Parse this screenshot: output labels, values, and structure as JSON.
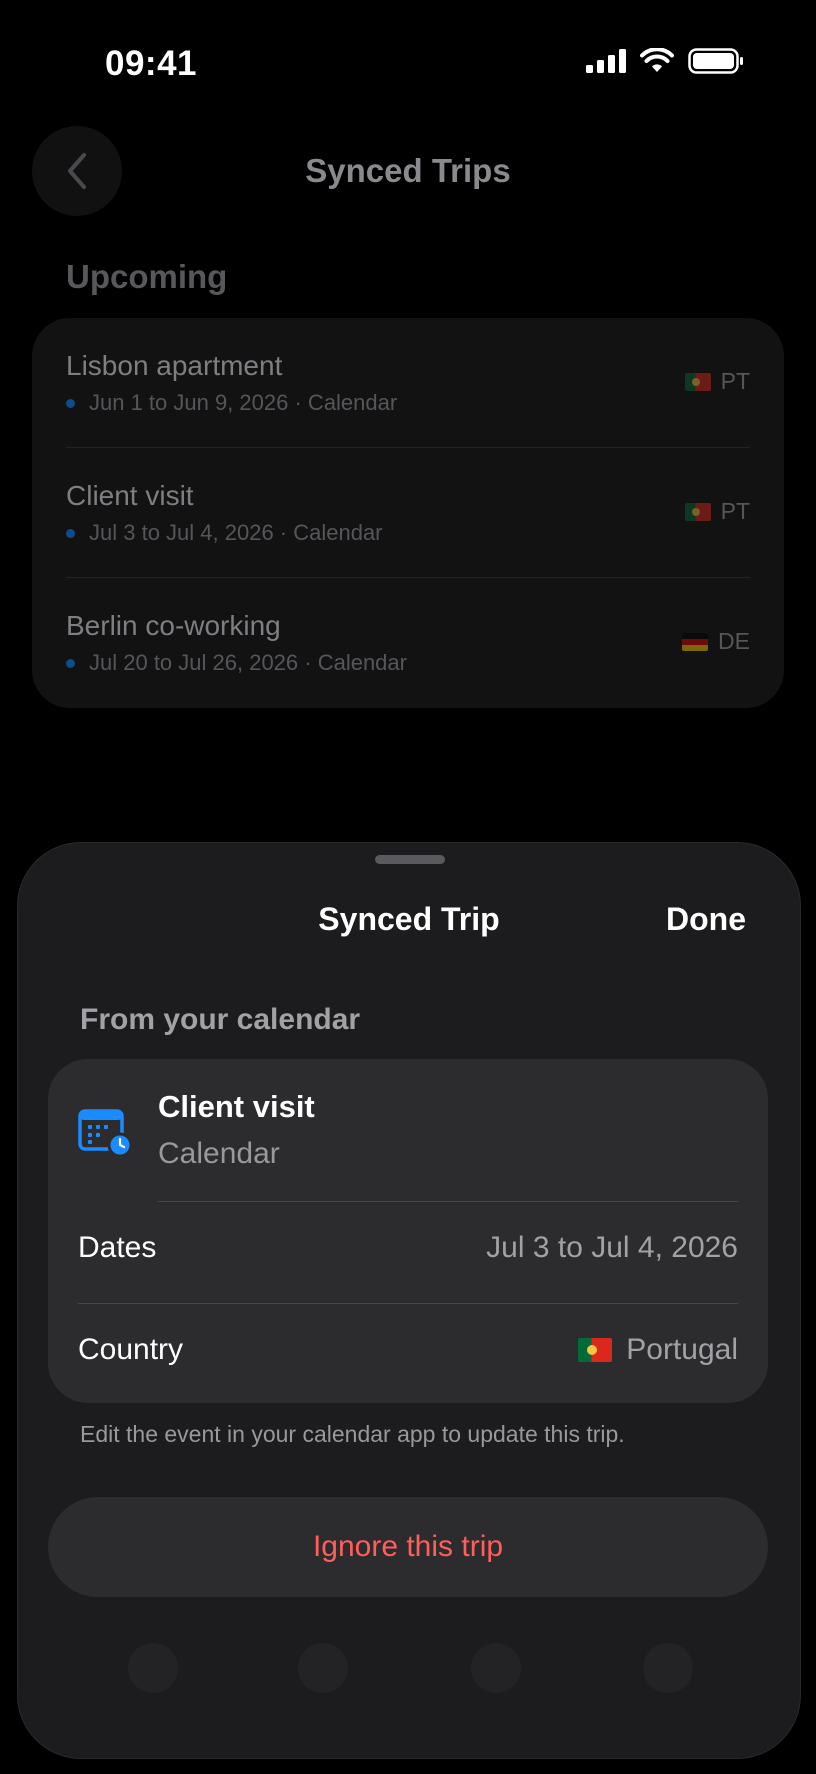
{
  "status_bar": {
    "time": "09:41"
  },
  "background": {
    "nav_title": "Synced Trips",
    "section_label": "Upcoming",
    "trips": [
      {
        "name": "Lisbon apartment",
        "subtitle": "Jun 1 to Jun 9, 2026 · Calendar",
        "country_code": "PT",
        "flag": "portugal-flag"
      },
      {
        "name": "Client visit",
        "subtitle": "Jul 3 to Jul 4, 2026 · Calendar",
        "country_code": "PT",
        "flag": "portugal-flag"
      },
      {
        "name": "Berlin co-working",
        "subtitle": "Jul 20 to Jul 26, 2026 · Calendar",
        "country_code": "DE",
        "flag": "germany-flag"
      }
    ]
  },
  "sheet": {
    "title": "Synced Trip",
    "done_label": "Done",
    "section_label": "From your calendar",
    "event": {
      "title": "Client visit",
      "source": "Calendar",
      "icon": "calendar-clock-icon"
    },
    "dates_label": "Dates",
    "dates_value": "Jul 3 to Jul 4, 2026",
    "country_label": "Country",
    "country_value": "Portugal",
    "note": "Edit the event in your calendar app to update this trip.",
    "ignore_label": "Ignore this trip"
  },
  "colors": {
    "accent_blue": "#1a8cff",
    "destructive_red": "#ff5e5b",
    "sheet_bg": "#1c1c1e",
    "card_bg": "#2c2c2e"
  }
}
